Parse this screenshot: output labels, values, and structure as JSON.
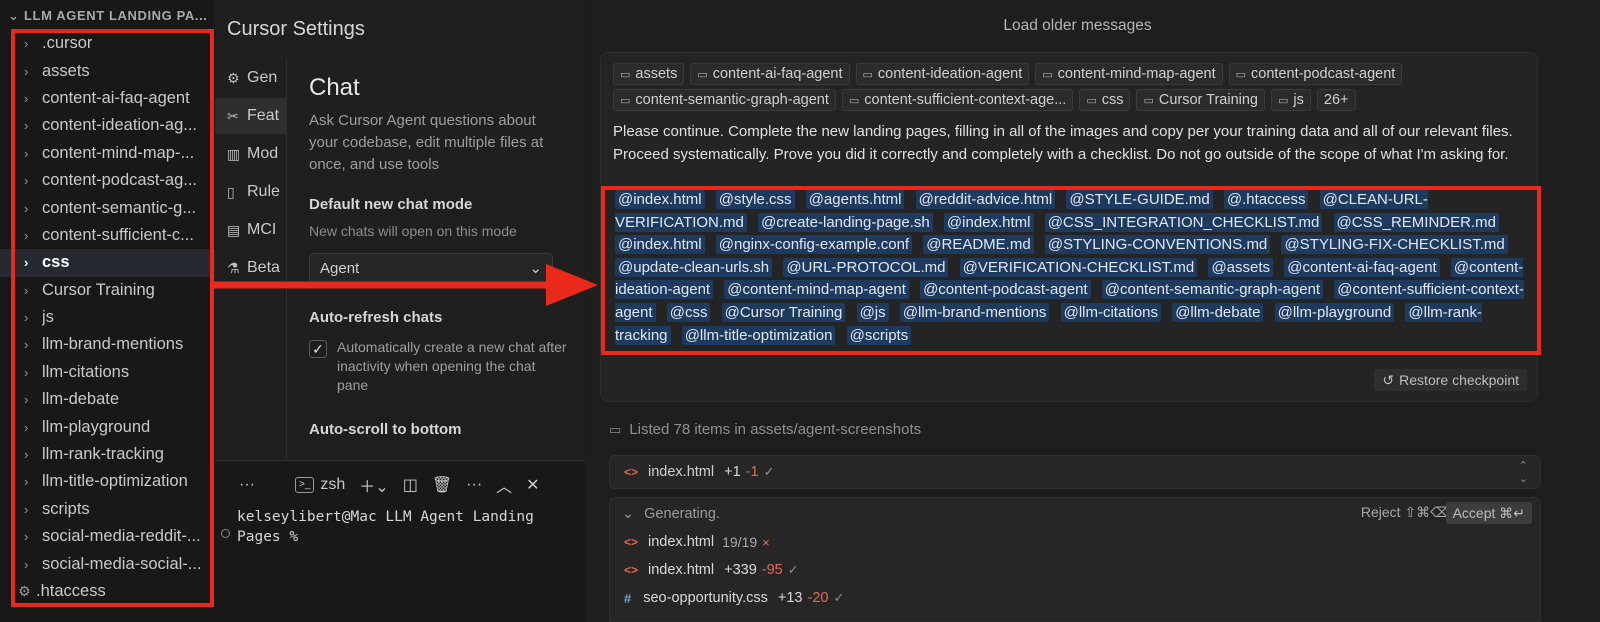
{
  "explorer": {
    "header": "LLM AGENT LANDING PA...",
    "items": [
      {
        "label": ".cursor",
        "type": "folder"
      },
      {
        "label": "assets",
        "type": "folder"
      },
      {
        "label": "content-ai-faq-agent",
        "type": "folder"
      },
      {
        "label": "content-ideation-ag...",
        "type": "folder"
      },
      {
        "label": "content-mind-map-...",
        "type": "folder"
      },
      {
        "label": "content-podcast-ag...",
        "type": "folder"
      },
      {
        "label": "content-semantic-g...",
        "type": "folder"
      },
      {
        "label": "content-sufficient-c...",
        "type": "folder"
      },
      {
        "label": "css",
        "type": "folder",
        "selected": true
      },
      {
        "label": "Cursor Training",
        "type": "folder"
      },
      {
        "label": "js",
        "type": "folder"
      },
      {
        "label": "llm-brand-mentions",
        "type": "folder"
      },
      {
        "label": "llm-citations",
        "type": "folder"
      },
      {
        "label": "llm-debate",
        "type": "folder"
      },
      {
        "label": "llm-playground",
        "type": "folder"
      },
      {
        "label": "llm-rank-tracking",
        "type": "folder"
      },
      {
        "label": "llm-title-optimization",
        "type": "folder"
      },
      {
        "label": "scripts",
        "type": "folder"
      },
      {
        "label": "social-media-reddit-...",
        "type": "folder"
      },
      {
        "label": "social-media-social-...",
        "type": "folder"
      },
      {
        "label": ".htaccess",
        "type": "file"
      }
    ]
  },
  "settings": {
    "title": "Cursor Settings",
    "nav": [
      {
        "label": "Gen",
        "icon": "gear-icon"
      },
      {
        "label": "Feat",
        "icon": "tools-icon",
        "active": true
      },
      {
        "label": "Mod",
        "icon": "bar-chart-icon"
      },
      {
        "label": "Rule",
        "icon": "document-icon"
      },
      {
        "label": "MCI",
        "icon": "server-icon"
      },
      {
        "label": "Beta",
        "icon": "flask-icon"
      }
    ],
    "chat_heading": "Chat",
    "chat_desc": "Ask Cursor Agent questions about your codebase, edit multiple files at once, and use tools",
    "default_mode_title": "Default new chat mode",
    "default_mode_desc": "New chats will open on this mode",
    "default_mode_value": "Agent",
    "auto_refresh_title": "Auto-refresh chats",
    "auto_refresh_check": "Automatically create a new chat after inactivity when opening the chat pane",
    "auto_scroll_title": "Auto-scroll to bottom"
  },
  "terminal": {
    "more": "···",
    "shell": "zsh",
    "output": "kelseylibert@Mac LLM Agent Landing Pages %"
  },
  "chat": {
    "load_older": "Load older messages",
    "context_tags": [
      "assets",
      "content-ai-faq-agent",
      "content-ideation-agent",
      "content-mind-map-agent",
      "content-podcast-agent",
      "content-semantic-graph-agent",
      "content-sufficient-context-age...",
      "css",
      "Cursor Training",
      "js",
      "26+"
    ],
    "message": "Please continue. Complete the new landing pages, filling in all of the images and copy per your training data and all of our relevant files. Proceed systematically. Prove you did it correctly and completely with a checklist. Do not go outside of the scope of what I'm asking for.",
    "mentions": [
      "@index.html",
      "@style.css",
      "@agents.html",
      "@reddit-advice.html",
      "@STYLE-GUIDE.md",
      "@.htaccess",
      "@CLEAN-URL-VERIFICATION.md",
      "@create-landing-page.sh",
      "@index.html",
      "@CSS_INTEGRATION_CHECKLIST.md",
      "@CSS_REMINDER.md",
      "@index.html",
      "@nginx-config-example.conf",
      "@README.md",
      "@STYLING-CONVENTIONS.md",
      "@STYLING-FIX-CHECKLIST.md",
      "@update-clean-urls.sh",
      "@URL-PROTOCOL.md",
      "@VERIFICATION-CHECKLIST.md",
      "@assets",
      "@content-ai-faq-agent",
      "@content-ideation-agent",
      "@content-mind-map-agent",
      "@content-podcast-agent",
      "@content-semantic-graph-agent",
      "@content-sufficient-context-agent",
      "@css",
      "@Cursor Training",
      "@js",
      "@llm-brand-mentions",
      "@llm-citations",
      "@llm-debate",
      "@llm-playground",
      "@llm-rank-tracking",
      "@llm-title-optimization",
      "@scripts"
    ],
    "restore_checkpoint": "Restore checkpoint",
    "listed": "Listed 78 items in assets/agent-screenshots",
    "file_row": {
      "name": "index.html",
      "added": "+1",
      "removed": "-1"
    },
    "generating": "Generating.",
    "reject": "Reject ⇧⌘⌫",
    "accept": "Accept ⌘↵",
    "gen_files": [
      {
        "name": "index.html",
        "stat": "19/19",
        "status": "×",
        "icon": "code-icon"
      },
      {
        "name": "index.html",
        "added": "+339",
        "removed": "-95",
        "icon": "code-icon"
      },
      {
        "name": "seo-opportunity.css",
        "added": "+13",
        "removed": "-20",
        "icon": "hash-icon"
      }
    ]
  },
  "colors": {
    "annotation_red": "#e8291c",
    "mention_bg": "#1f3a5f",
    "removed_red": "#e06b5b"
  }
}
